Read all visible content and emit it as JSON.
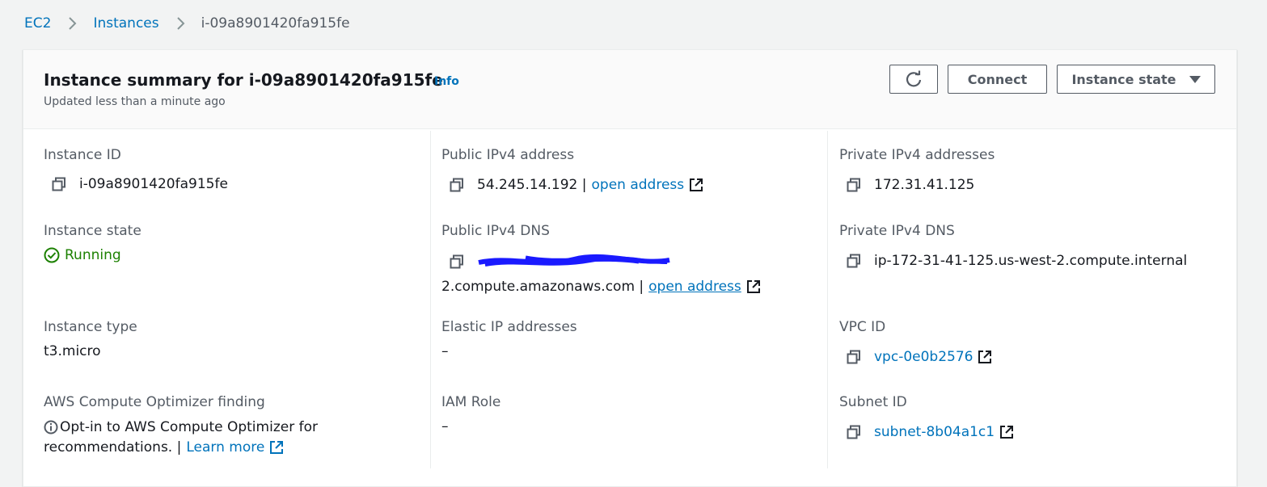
{
  "breadcrumb": {
    "items": [
      "EC2",
      "Instances"
    ],
    "current": "i-09a8901420fa915fe"
  },
  "header": {
    "title": "Instance summary for i-09a8901420fa915fe",
    "info": "Info",
    "updated": "Updated less than a minute ago",
    "connect_label": "Connect",
    "instance_state_label": "Instance state"
  },
  "details": {
    "col1": {
      "instance_id_label": "Instance ID",
      "instance_id": "i-09a8901420fa915fe",
      "instance_state_label": "Instance state",
      "instance_state": "Running",
      "instance_type_label": "Instance type",
      "instance_type": "t3.micro",
      "optimizer_label": "AWS Compute Optimizer finding",
      "optimizer_line1": "Opt-in to AWS Compute Optimizer for",
      "optimizer_line2": "recommendations. |",
      "learn_more": "Learn more"
    },
    "col2": {
      "public_ipv4_label": "Public IPv4 address",
      "public_ipv4": "54.245.14.192 |",
      "open_address": "open address",
      "public_dns_label": "Public IPv4 DNS",
      "public_dns_suffix": "2.compute.amazonaws.com |",
      "open_address_2": "open address",
      "elastic_ip_label": "Elastic IP addresses",
      "elastic_ip": "–",
      "iam_role_label": "IAM Role",
      "iam_role": "–"
    },
    "col3": {
      "private_ipv4_label": "Private IPv4 addresses",
      "private_ipv4": "172.31.41.125",
      "private_dns_label": "Private IPv4 DNS",
      "private_dns": "ip-172-31-41-125.us-west-2.compute.internal",
      "vpc_id_label": "VPC ID",
      "vpc_id": "vpc-0e0b2576",
      "subnet_id_label": "Subnet ID",
      "subnet_id": "subnet-8b04a1c1"
    }
  },
  "colors": {
    "link": "#0073bb",
    "running": "#1d8102",
    "redaction": "#1a1aff"
  },
  "icons": [
    "chevron-right-icon",
    "refresh-icon",
    "caret-down-icon",
    "copy-icon",
    "external-link-icon",
    "check-circle-icon",
    "info-circle-icon"
  ]
}
